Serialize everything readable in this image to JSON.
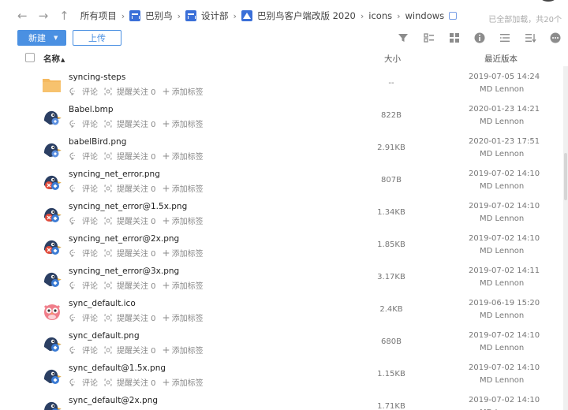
{
  "breadcrumb": {
    "items": [
      "所有项目",
      "巴别鸟",
      "设计部",
      "巴别鸟客户端改版 2020",
      "icons",
      "windows"
    ],
    "status": "已全部加载，共20个"
  },
  "toolbar": {
    "new_label": "新建",
    "upload_label": "上传"
  },
  "table": {
    "headers": {
      "name": "名称",
      "size": "大小",
      "version": "最近版本"
    },
    "action_labels": {
      "comment": "评论",
      "remind": "提醒关注 0",
      "tag": "添加标签"
    },
    "rows": [
      {
        "name": "syncing-steps",
        "size": "--",
        "date": "2019-07-05 14:24",
        "user": "MD Lennon",
        "icon": "folder-icon"
      },
      {
        "name": "Babel.bmp",
        "size": "822B",
        "date": "2020-01-23 14:21",
        "user": "MD Lennon",
        "icon": "bird-icon"
      },
      {
        "name": "babelBird.png",
        "size": "2.91KB",
        "date": "2020-01-23 17:51",
        "user": "MD Lennon",
        "icon": "bird-icon"
      },
      {
        "name": "syncing_net_error.png",
        "size": "807B",
        "date": "2019-07-02 14:10",
        "user": "MD Lennon",
        "icon": "bird-error-icon"
      },
      {
        "name": "syncing_net_error@1.5x.png",
        "size": "1.34KB",
        "date": "2019-07-02 14:10",
        "user": "MD Lennon",
        "icon": "bird-error-icon"
      },
      {
        "name": "syncing_net_error@2x.png",
        "size": "1.85KB",
        "date": "2019-07-02 14:10",
        "user": "MD Lennon",
        "icon": "bird-error-icon"
      },
      {
        "name": "syncing_net_error@3x.png",
        "size": "3.17KB",
        "date": "2019-07-02 14:11",
        "user": "MD Lennon",
        "icon": "bird-sync-icon"
      },
      {
        "name": "sync_default.ico",
        "size": "2.4KB",
        "date": "2019-06-19 15:20",
        "user": "MD Lennon",
        "icon": "owl-icon"
      },
      {
        "name": "sync_default.png",
        "size": "680B",
        "date": "2019-07-02 14:10",
        "user": "MD Lennon",
        "icon": "bird-sync-icon"
      },
      {
        "name": "sync_default@1.5x.png",
        "size": "1.15KB",
        "date": "2019-07-02 14:10",
        "user": "MD Lennon",
        "icon": "bird-sync-icon"
      },
      {
        "name": "sync_default@2x.png",
        "size": "1.71KB",
        "date": "2019-07-02 14:10",
        "user": "MD Lennon",
        "icon": "bird-sync-icon"
      }
    ]
  },
  "colors": {
    "accent": "#4a90e2",
    "folder": "#f5b95f",
    "bird": "#2b3f63",
    "error": "#e14b3b",
    "sync": "#3a7bd5",
    "owl": "#f07e8a"
  }
}
